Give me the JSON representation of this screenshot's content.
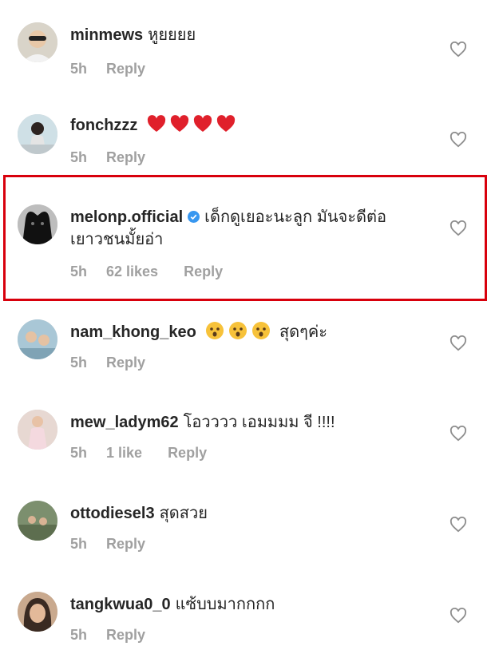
{
  "comments": [
    {
      "username": "minmews",
      "text": "หูยยยย",
      "time": "5h",
      "likes": "",
      "reply": "Reply",
      "avatar": "person-sunglasses-avatar"
    },
    {
      "username": "fonchzzz",
      "text": "",
      "emoji": [
        "heart",
        "heart",
        "heart",
        "heart"
      ],
      "time": "5h",
      "likes": "",
      "reply": "Reply",
      "avatar": "person-sitting-avatar"
    },
    {
      "username": "melonp.official",
      "text": "เด็กดูเยอะนะลูก มันจะดีต่อ",
      "text2": "เยาวชนมั้ยอ่า",
      "time": "5h",
      "likes": "62 likes",
      "reply": "Reply",
      "verified": true,
      "avatar": "black-animal-avatar"
    },
    {
      "username": "nam_khong_keo",
      "text": "สุดๆค่ะ",
      "emoji": [
        "astonished",
        "astonished",
        "astonished"
      ],
      "time": "5h",
      "likes": "",
      "reply": "Reply",
      "avatar": "group-photo-avatar"
    },
    {
      "username": "mew_ladym62",
      "text": "โอวววว เอมมมม จี !!!!",
      "time": "5h",
      "likes": "1 like",
      "reply": "Reply",
      "avatar": "woman-dress-avatar"
    },
    {
      "username": "ottodiesel3",
      "text": "สุดสวย",
      "time": "5h",
      "likes": "",
      "reply": "Reply",
      "avatar": "outdoor-people-avatar"
    },
    {
      "username": "tangkwua0_0",
      "text": "แซ้บบมากกกก",
      "time": "5h",
      "likes": "",
      "reply": "Reply",
      "avatar": "woman-face-avatar"
    }
  ],
  "colors": {
    "highlight": "#d8000c",
    "meta": "#a0a0a0",
    "verified": "#3897f0"
  }
}
